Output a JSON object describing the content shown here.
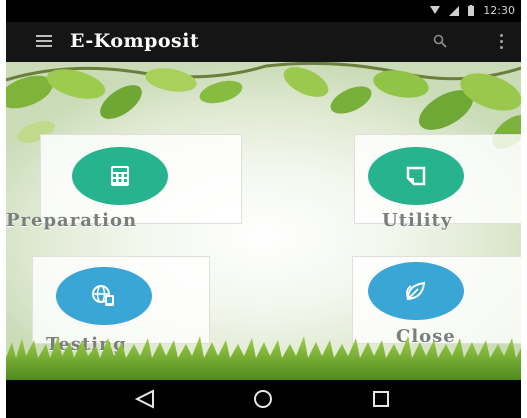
{
  "status": {
    "time": "12:30"
  },
  "app": {
    "title": "E-Komposit"
  },
  "menu": [
    {
      "id": "preparation",
      "label": "Preparation",
      "icon": "calculator-icon",
      "color": "#27b38d"
    },
    {
      "id": "utility",
      "label": "Utility",
      "icon": "note-icon",
      "color": "#27b38d"
    },
    {
      "id": "testing",
      "label": "Testing",
      "icon": "globe-device-icon",
      "color": "#3aa6d6"
    },
    {
      "id": "close",
      "label": "Close",
      "icon": "leaf-icon",
      "color": "#3aa6d6"
    }
  ]
}
